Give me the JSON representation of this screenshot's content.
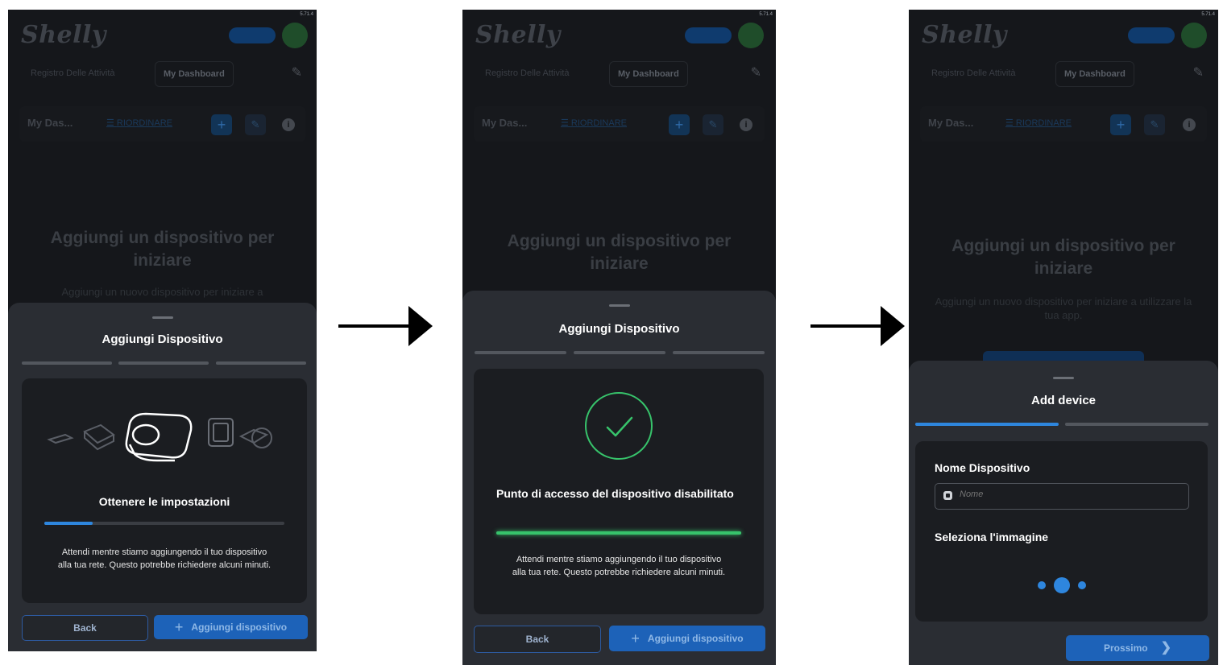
{
  "screens": [
    {
      "status_time": "5.71.4",
      "logo": "Shelly",
      "tabs": [
        "Registro Delle Attività",
        "My Dashboard"
      ],
      "dashboard": {
        "title": "My Das...",
        "order_label": "RIORDINARE"
      },
      "empty_title": "Aggiungi un dispositivo per iniziare",
      "empty_subtitle": "Aggiungi un nuovo dispositivo per iniziare a",
      "sheet": {
        "title": "Aggiungi Dispositivo",
        "steps_total": 3,
        "status_title": "Ottenere le impostazioni",
        "progress": 0.2,
        "wait_text": "Attendi mentre stiamo aggiungendo il tuo dispositivo alla tua rete. Questo potrebbe richiedere alcuni minuti.",
        "back_label": "Back",
        "add_label": "Aggiungi dispositivo"
      }
    },
    {
      "status_time": "5.71.4",
      "logo": "Shelly",
      "tabs": [
        "Registro Delle Attività",
        "My Dashboard"
      ],
      "dashboard": {
        "title": "My Das...",
        "order_label": "RIORDINARE"
      },
      "empty_title": "Aggiungi un dispositivo per iniziare",
      "sheet": {
        "title": "Aggiungi Dispositivo",
        "steps_total": 3,
        "status_title": "Punto di accesso del dispositivo disabilitato",
        "progress": 1.0,
        "wait_text": "Attendi mentre stiamo aggiungendo il tuo dispositivo alla tua rete. Questo potrebbe richiedere alcuni minuti.",
        "back_label": "Back",
        "add_label": "Aggiungi dispositivo"
      }
    },
    {
      "status_time": "5.71.4",
      "logo": "Shelly",
      "tabs": [
        "Registro Delle Attività",
        "My Dashboard"
      ],
      "dashboard": {
        "title": "My Das...",
        "order_label": "RIORDINARE"
      },
      "empty_title": "Aggiungi un dispositivo per iniziare",
      "empty_subtitle": "Aggiungi un nuovo dispositivo per iniziare a utilizzare la tua app.",
      "sheet": {
        "title": "Add device",
        "steps_total": 2,
        "steps_done": 1,
        "name_label": "Nome Dispositivo",
        "name_placeholder": "Nome",
        "image_label": "Seleziona l'immagine",
        "next_label": "Prossimo"
      }
    }
  ],
  "colors": {
    "accent_blue": "#2e86de",
    "success_green": "#37c36b",
    "background": "#15171b",
    "sheet": "#2a2d33"
  }
}
